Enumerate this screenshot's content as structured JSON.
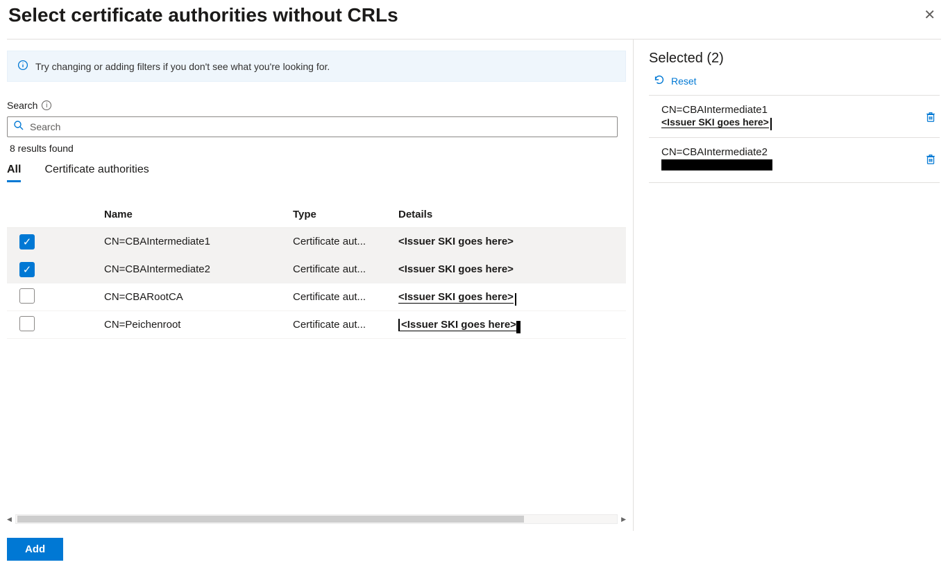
{
  "header": {
    "title": "Select certificate authorities without CRLs"
  },
  "banner": {
    "text": "Try changing or adding filters if you don't see what you're looking for."
  },
  "search": {
    "label": "Search",
    "placeholder": "Search"
  },
  "results_text": "8 results found",
  "tabs": {
    "all": "All",
    "ca": "Certificate authorities"
  },
  "table": {
    "headers": {
      "name": "Name",
      "type": "Type",
      "details": "Details"
    },
    "rows": [
      {
        "checked": true,
        "name": "CN=CBAIntermediate1",
        "type_display": "Certificate aut...",
        "details": "<Issuer SKI goes here>"
      },
      {
        "checked": true,
        "name": "CN=CBAIntermediate2",
        "type_display": "Certificate aut...",
        "details": "<Issuer SKI goes here>"
      },
      {
        "checked": false,
        "name": "CN=CBARootCA",
        "type_display": "Certificate aut...",
        "details": "<Issuer SKI goes here>"
      },
      {
        "checked": false,
        "name": "CN=Peichenroot",
        "type_display": "Certificate aut...",
        "details": "<Issuer SKI goes here>"
      }
    ]
  },
  "selected": {
    "title": "Selected (2)",
    "reset": "Reset",
    "items": [
      {
        "name": "CN=CBAIntermediate1",
        "sub": "<Issuer SKI goes here>"
      },
      {
        "name": "CN=CBAIntermediate2",
        "sub_redacted": true
      }
    ]
  },
  "footer": {
    "add": "Add"
  }
}
